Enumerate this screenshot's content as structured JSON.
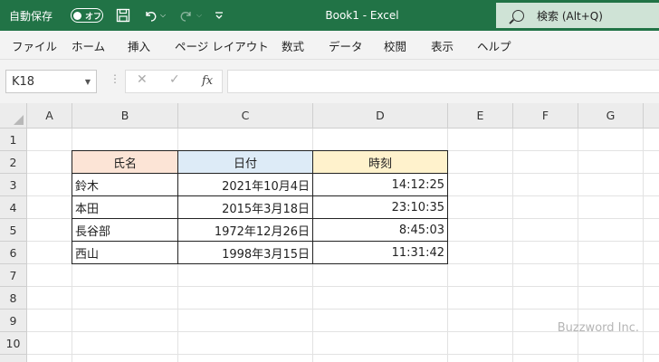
{
  "titlebar": {
    "autosave_label": "自動保存",
    "autosave_state": "オフ",
    "document_title": "Book1  -  Excel",
    "search_placeholder": "検索 (Alt+Q)",
    "background": "#217346",
    "search_background": "#cfe3d6",
    "icons": {
      "save": "floppy-disk-icon",
      "undo": "undo-icon",
      "redo": "redo-icon",
      "customize": "customize-quick-access-icon",
      "search": "search-icon"
    }
  },
  "ribbon_tabs": [
    "ファイル",
    "ホーム",
    "挿入",
    "ページ レイアウト",
    "数式",
    "データ",
    "校閲",
    "表示",
    "ヘルプ"
  ],
  "formula_bar": {
    "name_box": "K18",
    "cancel_symbol": "✕",
    "enter_symbol": "✓",
    "fx_label": "fx",
    "formula": ""
  },
  "sheet": {
    "columns": [
      "A",
      "B",
      "C",
      "D",
      "E",
      "F",
      "G"
    ],
    "rows": [
      "1",
      "2",
      "3",
      "4",
      "5",
      "6",
      "7",
      "8",
      "9",
      "10"
    ],
    "table": {
      "headers": [
        {
          "text": "氏名",
          "fill": "#fce4d6"
        },
        {
          "text": "日付",
          "fill": "#ddebf7"
        },
        {
          "text": "時刻",
          "fill": "#fff2cc"
        }
      ],
      "rows": [
        [
          "鈴木",
          "2021年10月4日",
          "14:12:25"
        ],
        [
          "本田",
          "2015年3月18日",
          "23:10:35"
        ],
        [
          "長谷部",
          "1972年12月26日",
          "8:45:03"
        ],
        [
          "西山",
          "1998年3月15日",
          "11:31:42"
        ]
      ]
    }
  },
  "watermark": "Buzzword Inc."
}
